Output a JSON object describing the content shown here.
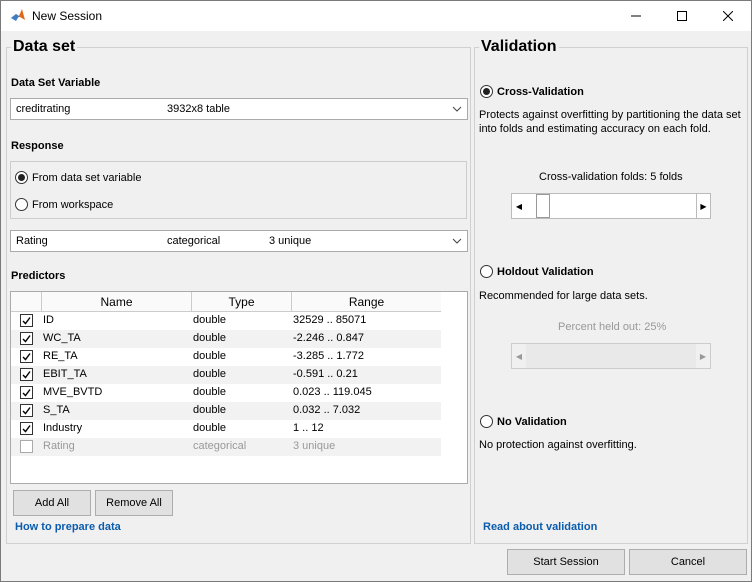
{
  "window": {
    "title": "New Session"
  },
  "dataset": {
    "section_title": "Data set",
    "variable_label": "Data Set Variable",
    "variable_name": "creditrating",
    "variable_size": "3932x8 table",
    "response_label": "Response",
    "radio_from_dataset": "From data set variable",
    "radio_from_workspace": "From workspace",
    "response_name": "Rating",
    "response_type": "categorical",
    "response_unique": "3 unique",
    "predictors_label": "Predictors",
    "columns": [
      "Name",
      "Type",
      "Range"
    ],
    "rows": [
      {
        "name": "ID",
        "type": "double",
        "range": "32529 .. 85071",
        "checked": true
      },
      {
        "name": "WC_TA",
        "type": "double",
        "range": "-2.246 .. 0.847",
        "checked": true
      },
      {
        "name": "RE_TA",
        "type": "double",
        "range": "-3.285 .. 1.772",
        "checked": true
      },
      {
        "name": "EBIT_TA",
        "type": "double",
        "range": "-0.591 .. 0.21",
        "checked": true
      },
      {
        "name": "MVE_BVTD",
        "type": "double",
        "range": "0.023 .. 119.045",
        "checked": true
      },
      {
        "name": "S_TA",
        "type": "double",
        "range": "0.032 .. 7.032",
        "checked": true
      },
      {
        "name": "Industry",
        "type": "double",
        "range": "1 .. 12",
        "checked": true
      },
      {
        "name": "Rating",
        "type": "categorical",
        "range": "3 unique",
        "checked": false
      }
    ],
    "add_all": "Add All",
    "remove_all": "Remove All",
    "help_link": "How to prepare data"
  },
  "validation": {
    "section_title": "Validation",
    "cv_label": "Cross-Validation",
    "cv_desc_1": "Protects against overfitting by partitioning the data set",
    "cv_desc_2": "into folds and estimating accuracy on each fold.",
    "cv_folds_label": "Cross-validation folds: 5 folds",
    "holdout_label": "Holdout Validation",
    "holdout_desc": "Recommended for large data sets.",
    "holdout_percent_label": "Percent held out: 25%",
    "none_label": "No Validation",
    "none_desc": "No protection against overfitting.",
    "read_link": "Read about validation"
  },
  "footer": {
    "start": "Start Session",
    "cancel": "Cancel"
  }
}
